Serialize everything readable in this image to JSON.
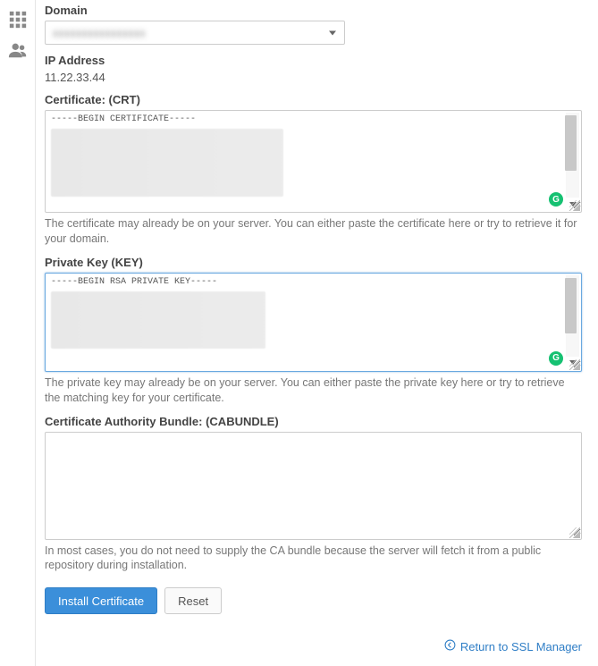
{
  "sidebar": {
    "items": [
      {
        "name": "apps-icon"
      },
      {
        "name": "users-icon"
      }
    ]
  },
  "domain": {
    "label": "Domain",
    "selected": "xxxxxxxxxxxxxxxx"
  },
  "ip": {
    "label": "IP Address",
    "value": "11.22.33.44"
  },
  "crt": {
    "label": "Certificate: (CRT)",
    "header_line": "-----BEGIN CERTIFICATE-----",
    "help": "The certificate may already be on your server. You can either paste the certificate here or try to retrieve it for your domain."
  },
  "key": {
    "label": "Private Key (KEY)",
    "header_line": "-----BEGIN RSA PRIVATE KEY-----",
    "help": "The private key may already be on your server. You can either paste the private key here or try to retrieve the matching key for your certificate."
  },
  "cabundle": {
    "label": "Certificate Authority Bundle: (CABUNDLE)",
    "value": "",
    "help": "In most cases, you do not need to supply the CA bundle because the server will fetch it from a public repository during installation."
  },
  "buttons": {
    "install": "Install Certificate",
    "reset": "Reset"
  },
  "return_link": {
    "label": "Return to SSL Manager"
  }
}
